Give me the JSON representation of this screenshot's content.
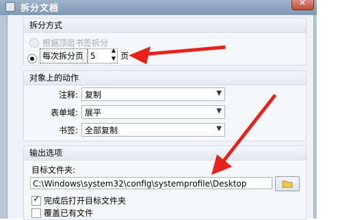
{
  "window": {
    "title": "拆分文档"
  },
  "split": {
    "heading": "拆分方式",
    "option_bookmark": "根据顶层书签拆分",
    "option_pages": "每次拆分页",
    "pages_value": "5",
    "pages_suffix": "页"
  },
  "object_actions": {
    "heading": "对象上的动作",
    "rows": [
      {
        "label": "注释:",
        "value": "复制"
      },
      {
        "label": "表单域:",
        "value": "展平"
      },
      {
        "label": "书签:",
        "value": "全部复制"
      }
    ]
  },
  "output": {
    "heading": "输出选项",
    "folder_label": "目标文件夹:",
    "folder_value": "C:\\Windows\\system32\\config\\systemprofile\\Desktop",
    "open_folder_label": "完成后打开目标文件夹",
    "open_folder_checked": true,
    "overwrite_label": "覆盖已有文件",
    "overwrite_checked": false
  },
  "colors": {
    "annotation_arrow": "#e8221b",
    "title_bar": "#8aa2bd"
  },
  "icons": {
    "folder_button": "folder-icon",
    "combo_arrow": "chevron-down-icon"
  }
}
